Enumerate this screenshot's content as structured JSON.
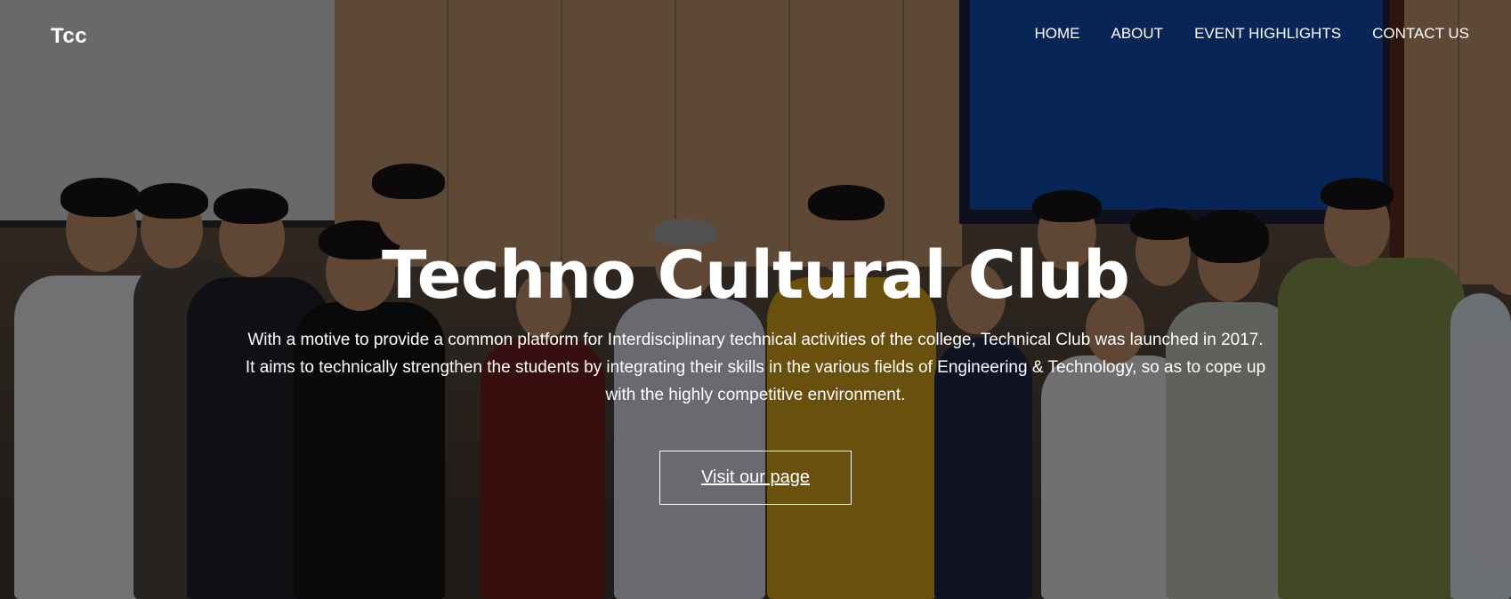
{
  "header": {
    "logo": "Tcc",
    "nav": [
      {
        "label": "HOME"
      },
      {
        "label": "ABOUT"
      },
      {
        "label": "EVENT HIGHLIGHTS"
      },
      {
        "label": "CONTACT US"
      }
    ]
  },
  "hero": {
    "title": "Techno Cultural Club",
    "description": "With a motive to provide a common platform for Interdisciplinary technical activities of the college, Technical Club was launched in 2017. It aims to technically strengthen the students by integrating their skills in the various fields of Engineering & Technology, so as to cope up with the highly competitive environment.",
    "cta_label": "Visit our page"
  },
  "colors": {
    "text": "#ffffff",
    "overlay": "rgba(0,0,0,0.48)"
  }
}
